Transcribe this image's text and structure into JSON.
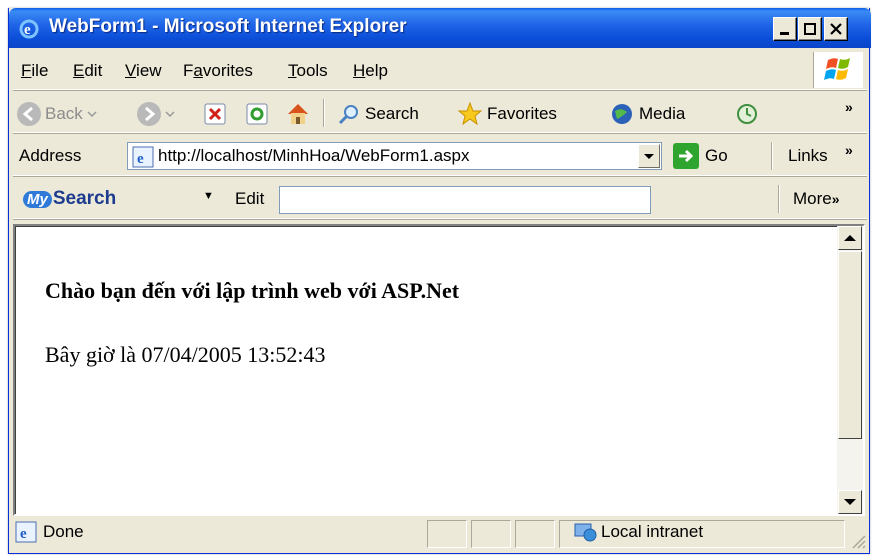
{
  "window": {
    "title": "WebForm1 - Microsoft Internet Explorer",
    "app_icon": "ie-icon",
    "controls": [
      "minimize-icon",
      "maximize-icon",
      "close-icon"
    ]
  },
  "menu": {
    "items": [
      {
        "label": "File",
        "accel": "F"
      },
      {
        "label": "Edit",
        "accel": "E"
      },
      {
        "label": "View",
        "accel": "V"
      },
      {
        "label": "Favorites",
        "accel": "a"
      },
      {
        "label": "Tools",
        "accel": "T"
      },
      {
        "label": "Help",
        "accel": "H"
      }
    ]
  },
  "toolbar": {
    "back_label": "Back",
    "search_label": "Search",
    "favorites_label": "Favorites",
    "media_label": "Media",
    "overflow": "»"
  },
  "addressbar": {
    "label": "Address",
    "url": "http://localhost/MinhHoa/WebForm1.aspx",
    "go_label": "Go",
    "links_label": "Links",
    "overflow": "»"
  },
  "mysearch": {
    "logo_my": "My",
    "logo_search": "Search",
    "edit_label": "Edit",
    "input_value": "",
    "more_label": "More"
  },
  "page": {
    "heading": "Chào bạn đến với lập trình web với ASP.Net",
    "time_line": "Bây giờ là 07/04/2005 13:52:43"
  },
  "statusbar": {
    "status_text": "Done",
    "zone_text": "Local intranet"
  },
  "colors": {
    "titlebar": "#2166e8",
    "chrome": "#ece9d8",
    "go_green": "#2fa52f"
  }
}
